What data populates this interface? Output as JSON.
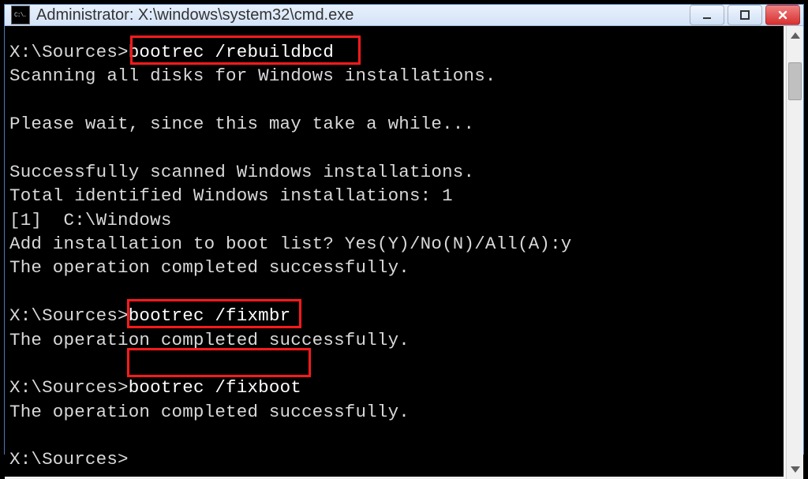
{
  "window": {
    "title": "Administrator: X:\\windows\\system32\\cmd.exe",
    "icon_label": "C:\\."
  },
  "highlight_color": "#ff1a1a",
  "terminal": {
    "prompts": [
      "X:\\Sources>",
      "X:\\Sources>",
      "X:\\Sources>",
      "X:\\Sources>"
    ],
    "commands": [
      "bootrec /rebuildbcd",
      "bootrec /fixmbr",
      "bootrec /fixboot"
    ],
    "lines": {
      "scan": "Scanning all disks for Windows installations.",
      "wait": "Please wait, since this may take a while...",
      "success_scan": "Successfully scanned Windows installations.",
      "total": "Total identified Windows installations: 1",
      "entry": "[1]  C:\\Windows",
      "addq": "Add installation to boot list? Yes(Y)/No(N)/All(A):y",
      "opdone": "The operation completed successfully."
    }
  }
}
